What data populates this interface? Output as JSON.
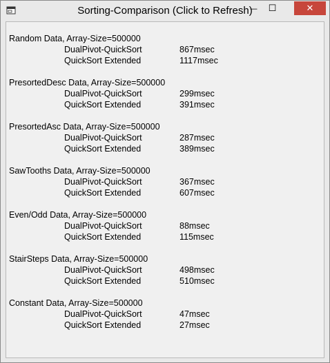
{
  "window": {
    "title": "Sorting-Comparison (Click to Refresh)",
    "minimize_glyph": "—",
    "maximize_glyph": "☐",
    "close_glyph": "✕"
  },
  "results": [
    {
      "heading": "Random Data, Array-Size=500000",
      "rows": [
        {
          "algorithm": "DualPivot-QuickSort",
          "time": "867msec"
        },
        {
          "algorithm": "QuickSort Extended",
          "time": "1117msec"
        }
      ]
    },
    {
      "heading": "PresortedDesc Data, Array-Size=500000",
      "rows": [
        {
          "algorithm": "DualPivot-QuickSort",
          "time": "299msec"
        },
        {
          "algorithm": "QuickSort Extended",
          "time": "391msec"
        }
      ]
    },
    {
      "heading": "PresortedAsc Data, Array-Size=500000",
      "rows": [
        {
          "algorithm": "DualPivot-QuickSort",
          "time": "287msec"
        },
        {
          "algorithm": "QuickSort Extended",
          "time": "389msec"
        }
      ]
    },
    {
      "heading": "SawTooths Data, Array-Size=500000",
      "rows": [
        {
          "algorithm": "DualPivot-QuickSort",
          "time": "367msec"
        },
        {
          "algorithm": "QuickSort Extended",
          "time": "607msec"
        }
      ]
    },
    {
      "heading": "Even/Odd Data, Array-Size=500000",
      "rows": [
        {
          "algorithm": "DualPivot-QuickSort",
          "time": "88msec"
        },
        {
          "algorithm": "QuickSort Extended",
          "time": "115msec"
        }
      ]
    },
    {
      "heading": "StairSteps Data, Array-Size=500000",
      "rows": [
        {
          "algorithm": "DualPivot-QuickSort",
          "time": "498msec"
        },
        {
          "algorithm": "QuickSort Extended",
          "time": "510msec"
        }
      ]
    },
    {
      "heading": "Constant Data, Array-Size=500000",
      "rows": [
        {
          "algorithm": "DualPivot-QuickSort",
          "time": "47msec"
        },
        {
          "algorithm": "QuickSort Extended",
          "time": "27msec"
        }
      ]
    }
  ],
  "colors": {
    "close_button": "#c7463b",
    "window_frame": "#e9e9e9",
    "client_background": "#f0f0f0"
  }
}
